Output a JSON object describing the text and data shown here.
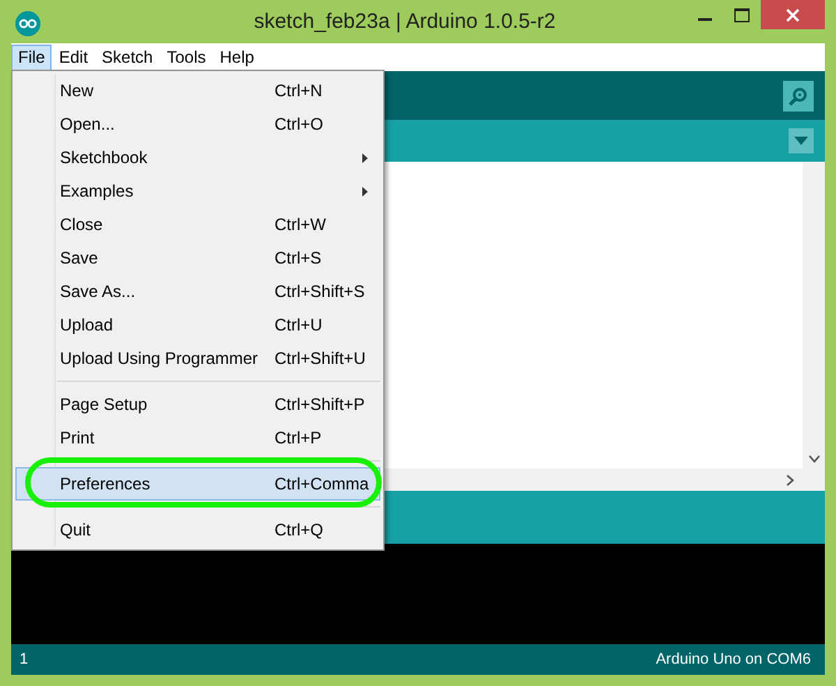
{
  "window": {
    "title": "sketch_feb23a | Arduino 1.0.5-r2"
  },
  "menu_bar": [
    {
      "label": "File",
      "selected": true
    },
    {
      "label": "Edit",
      "selected": false
    },
    {
      "label": "Sketch",
      "selected": false
    },
    {
      "label": "Tools",
      "selected": false
    },
    {
      "label": "Help",
      "selected": false
    }
  ],
  "file_menu": [
    {
      "kind": "item",
      "label": "New",
      "shortcut": "Ctrl+N",
      "submenu": false,
      "selected": false
    },
    {
      "kind": "item",
      "label": "Open...",
      "shortcut": "Ctrl+O",
      "submenu": false,
      "selected": false
    },
    {
      "kind": "item",
      "label": "Sketchbook",
      "submenu": true,
      "selected": false
    },
    {
      "kind": "item",
      "label": "Examples",
      "submenu": true,
      "selected": false
    },
    {
      "kind": "item",
      "label": "Close",
      "shortcut": "Ctrl+W",
      "submenu": false,
      "selected": false
    },
    {
      "kind": "item",
      "label": "Save",
      "shortcut": "Ctrl+S",
      "submenu": false,
      "selected": false
    },
    {
      "kind": "item",
      "label": "Save As...",
      "shortcut": "Ctrl+Shift+S",
      "submenu": false,
      "selected": false
    },
    {
      "kind": "item",
      "label": "Upload",
      "shortcut": "Ctrl+U",
      "submenu": false,
      "selected": false
    },
    {
      "kind": "item",
      "label": "Upload Using Programmer",
      "shortcut": "Ctrl+Shift+U",
      "submenu": false,
      "selected": false
    },
    {
      "kind": "separator"
    },
    {
      "kind": "item",
      "label": "Page Setup",
      "shortcut": "Ctrl+Shift+P",
      "submenu": false,
      "selected": false
    },
    {
      "kind": "item",
      "label": "Print",
      "shortcut": "Ctrl+P",
      "submenu": false,
      "selected": false
    },
    {
      "kind": "separator"
    },
    {
      "kind": "item",
      "label": "Preferences",
      "shortcut": "Ctrl+Comma",
      "submenu": false,
      "selected": true,
      "circled": true
    },
    {
      "kind": "separator"
    },
    {
      "kind": "item",
      "label": "Quit",
      "shortcut": "Ctrl+Q",
      "submenu": false,
      "selected": false
    }
  ],
  "status_bar": {
    "line": "1",
    "board": "Arduino Uno on COM6"
  }
}
